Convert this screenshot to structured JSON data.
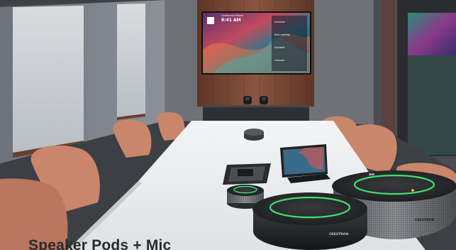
{
  "caption": "Speaker Pods + Mic",
  "wall_display": {
    "time": "8:41 AM",
    "line1": "Conference Room",
    "list_items": [
      "Schedule",
      "Next meeting",
      "Available",
      "Calendar"
    ]
  },
  "brand_badge": "CRESTRON",
  "colors": {
    "accent_ring": "#3ee06a",
    "speaker_body": "#2b2c2f",
    "table": "#e9ebed",
    "chair": "#c9866a",
    "wall_wood": "#7a4a36"
  }
}
